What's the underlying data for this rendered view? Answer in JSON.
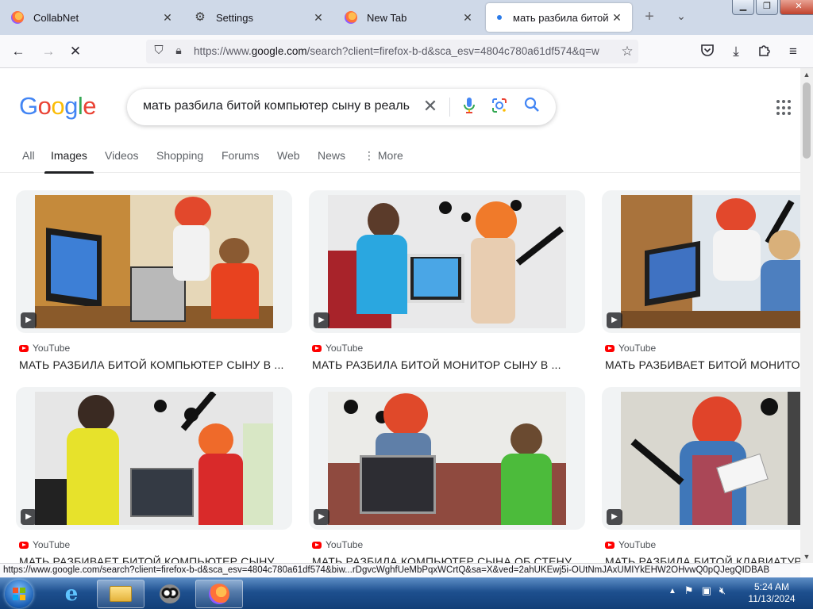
{
  "browser": {
    "tabs": [
      {
        "label": "CollabNet",
        "icon": "firefox-icon"
      },
      {
        "label": "Settings",
        "icon": "gear-icon"
      },
      {
        "label": "New Tab",
        "icon": "firefox-icon"
      },
      {
        "label": "мать разбила битой ко",
        "icon": "loading-dot-icon",
        "active": true
      }
    ],
    "url": {
      "prefix": "https://www.",
      "domain": "google.com",
      "rest": "/search?client=firefox-b-d&sca_esv=4804c780a61df574&q=w"
    }
  },
  "google": {
    "logo_letters": [
      {
        "ch": "G",
        "color": "#4285F4"
      },
      {
        "ch": "o",
        "color": "#EA4335"
      },
      {
        "ch": "o",
        "color": "#FBBC05"
      },
      {
        "ch": "g",
        "color": "#4285F4"
      },
      {
        "ch": "l",
        "color": "#34A853"
      },
      {
        "ch": "e",
        "color": "#EA4335"
      }
    ],
    "query": "мать разбила битой компьютер сыну в реаль",
    "tabs": [
      {
        "label": "All"
      },
      {
        "label": "Images",
        "selected": true
      },
      {
        "label": "Videos"
      },
      {
        "label": "Shopping"
      },
      {
        "label": "Forums"
      },
      {
        "label": "Web"
      },
      {
        "label": "News"
      },
      {
        "label": "⋮ More"
      }
    ]
  },
  "results": [
    {
      "source": "YouTube",
      "title": "МАТЬ РАЗБИЛА БИТОЙ КОМПЬЮТЕР СЫНУ В ..."
    },
    {
      "source": "YouTube",
      "title": "МАТЬ РАЗБИЛА БИТОЙ МОНИТОР СЫНУ В ..."
    },
    {
      "source": "YouTube",
      "title": "МАТЬ РАЗБИВАЕТ БИТОЙ МОНИТОР"
    },
    {
      "source": "YouTube",
      "title": "МАТЬ РАЗБИВАЕТ БИТОЙ КОМПЬЮТЕР СЫНУ"
    },
    {
      "source": "YouTube",
      "title": "МАТЬ РАЗБИЛА КОМПЬЮТЕР СЫНА ОБ СТЕНУ"
    },
    {
      "source": "YouTube",
      "title": "МАТЬ РАЗБИЛА БИТОЙ КЛАВИАТУРУ"
    }
  ],
  "status_link": "https://www.google.com/search?client=firefox-b-d&sca_esv=4804c780a61df574&biw...rDgvcWghfUeMbPqxWCrtQ&sa=X&ved=2ahUKEwj5i-OUtNmJAxUMIYkEHW2OHvwQ0pQJegQIDBAB",
  "taskbar": {
    "time": "5:24 AM",
    "date": "11/13/2024"
  },
  "colors": {
    "google_blue": "#4285F4",
    "youtube_red": "#FF0000",
    "taskbar": "#1D4F8E"
  }
}
